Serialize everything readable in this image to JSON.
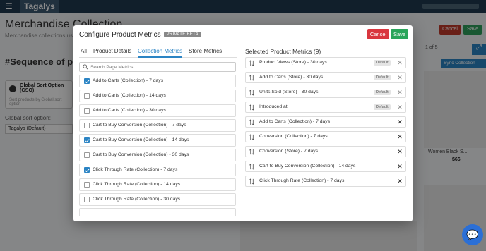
{
  "app": {
    "logo": "Tagalys",
    "page_title": "Merchandise Collection",
    "page_subtitle": "Merchandise collections using se",
    "cancel_label": "Cancel",
    "save_label": "Save",
    "sequence_heading": "#Sequence of produ",
    "gso_title": "Global Sort Option (GSO)",
    "gso_desc": "Sort products by Global sort option",
    "global_sort_label": "Global sort option:",
    "global_sort_value": "Tagalys (Default)",
    "pager_text": "1 of 5",
    "sync_label": "Sync Collection",
    "product_name": "Women Black S...",
    "product_price": "$66"
  },
  "modal": {
    "title": "Configure Product Metrics",
    "badge": "PRIVATE BETA",
    "cancel_label": "Cancel",
    "save_label": "Save",
    "tabs": [
      {
        "label": "All",
        "active": false
      },
      {
        "label": "Product Details",
        "active": false
      },
      {
        "label": "Collection Metrics",
        "active": true
      },
      {
        "label": "Store Metrics",
        "active": false
      }
    ],
    "search_placeholder": "Search Page Metrics",
    "metrics": [
      {
        "label": "Add to Carts (Collection) - 7 days",
        "checked": true
      },
      {
        "label": "Add to Carts (Collection) - 14 days",
        "checked": false
      },
      {
        "label": "Add to Carts (Collection) - 30 days",
        "checked": false
      },
      {
        "label": "Cart to Buy Conversion (Collection) - 7 days",
        "checked": false
      },
      {
        "label": "Cart to Buy Conversion (Collection) - 14 days",
        "checked": true
      },
      {
        "label": "Cart to Buy Conversion (Collection) - 30 days",
        "checked": false
      },
      {
        "label": "Click Through Rate (Collection) - 7 days",
        "checked": true
      },
      {
        "label": "Click Through Rate (Collection) - 14 days",
        "checked": false
      },
      {
        "label": "Click Through Rate (Collection) - 30 days",
        "checked": false
      }
    ],
    "selected_title": "Selected Product Metrics (9)",
    "selected": [
      {
        "label": "Product Views (Store) - 30 days",
        "default": "Default"
      },
      {
        "label": "Add to Carts (Store) - 30 days",
        "default": "Default"
      },
      {
        "label": "Units Sold (Store) - 30 days",
        "default": "Default"
      },
      {
        "label": "Introduced at",
        "default": "Default"
      },
      {
        "label": "Add to Carts (Collection) - 7 days",
        "default": ""
      },
      {
        "label": "Conversion (Collection) - 7 days",
        "default": ""
      },
      {
        "label": "Conversion (Store) - 7 days",
        "default": ""
      },
      {
        "label": "Cart to Buy Conversion (Collection) - 14 days",
        "default": ""
      },
      {
        "label": "Click Through Rate (Collection) - 7 days",
        "default": ""
      }
    ]
  },
  "colors": {
    "accent": "#2b84c4",
    "danger": "#d9363e",
    "success": "#2aa55a"
  }
}
